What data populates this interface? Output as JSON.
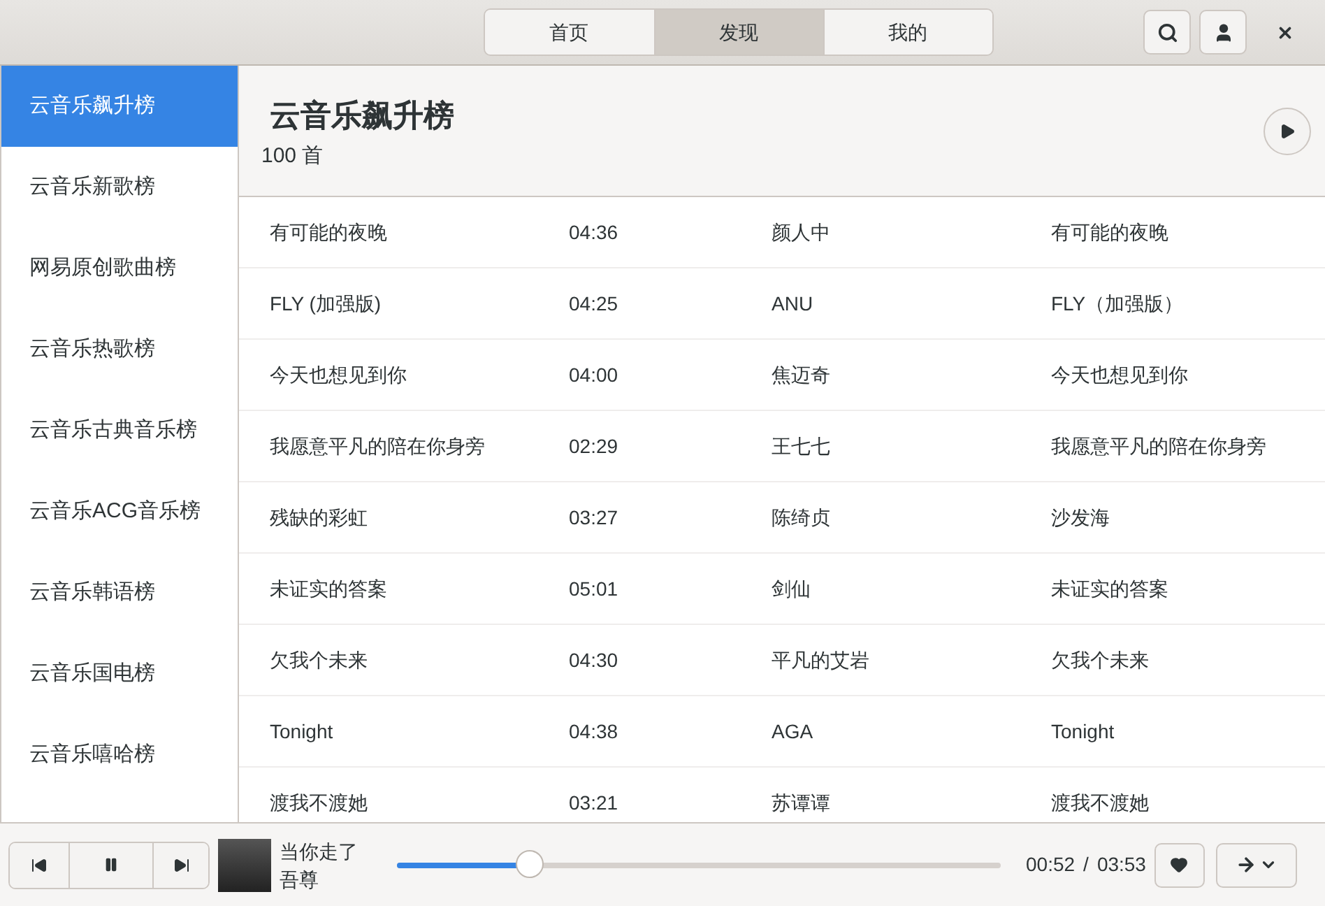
{
  "header": {
    "tabs": [
      {
        "label": "首页",
        "selected": false
      },
      {
        "label": "发现",
        "selected": true
      },
      {
        "label": "我的",
        "selected": false
      }
    ]
  },
  "sidebar": {
    "items": [
      {
        "label": "云音乐飙升榜",
        "selected": true
      },
      {
        "label": "云音乐新歌榜",
        "selected": false
      },
      {
        "label": "网易原创歌曲榜",
        "selected": false
      },
      {
        "label": "云音乐热歌榜",
        "selected": false
      },
      {
        "label": "云音乐古典音乐榜",
        "selected": false
      },
      {
        "label": "云音乐ACG音乐榜",
        "selected": false
      },
      {
        "label": "云音乐韩语榜",
        "selected": false
      },
      {
        "label": "云音乐国电榜",
        "selected": false
      },
      {
        "label": "云音乐嘻哈榜",
        "selected": false
      }
    ]
  },
  "playlist": {
    "title": "云音乐飙升榜",
    "count": "100 首"
  },
  "table": {
    "rows": [
      [
        "有可能的夜晚",
        "04:36",
        "颜人中",
        "有可能的夜晚"
      ],
      [
        "FLY (加强版)",
        "04:25",
        "ANU",
        "FLY（加强版）"
      ],
      [
        "今天也想见到你",
        "04:00",
        "焦迈奇",
        "今天也想见到你"
      ],
      [
        "我愿意平凡的陪在你身旁",
        "02:29",
        "王七七",
        "我愿意平凡的陪在你身旁"
      ],
      [
        "残缺的彩虹",
        "03:27",
        "陈绮贞",
        "沙发海"
      ],
      [
        "未证实的答案",
        "05:01",
        "剑仙",
        "未证实的答案"
      ],
      [
        "欠我个未来",
        "04:30",
        "平凡的艾岩",
        "欠我个未来"
      ],
      [
        "Tonight",
        "04:38",
        "AGA",
        "Tonight"
      ],
      [
        "渡我不渡她",
        "03:21",
        "苏谭谭",
        "渡我不渡她"
      ]
    ]
  },
  "player": {
    "title": "当你走了",
    "artist": "吾尊",
    "level": 0.22,
    "elapsed": "00:52",
    "separator": "/",
    "duration": "03:53"
  }
}
